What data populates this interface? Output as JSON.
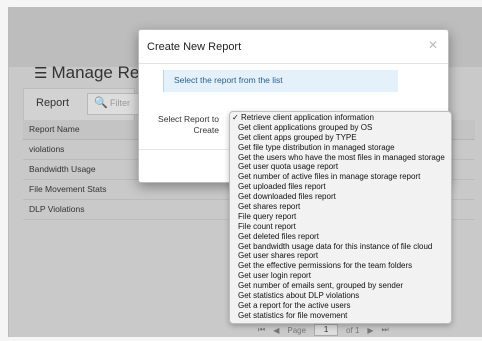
{
  "background_page": {
    "title": "Manage Reports",
    "title_icon": "list-icon",
    "report_tab_label": "Report",
    "search_placeholder": "Filter",
    "table": {
      "header": "Report Name",
      "rows": [
        "violations",
        "Bandwidth Usage",
        "File Movement Stats",
        "DLP Violations"
      ]
    },
    "pager": {
      "page_label": "Page",
      "page_value": "1",
      "of_label": "of 1"
    }
  },
  "modal": {
    "title": "Create New Report",
    "close_icon": "close-icon",
    "info_text": "Select the report from the list",
    "select_label_line1": "Select Report to",
    "select_label_line2": "Create"
  },
  "dropdown": {
    "checkmark": "✓",
    "options": [
      "Retrieve client application information",
      "Get client applications grouped by OS",
      "Get client apps grouped by TYPE",
      "Get file type distribution in managed storage",
      "Get the users who have the most files in managed storage",
      "Get user quota usage report",
      "Get number of active files in manage storage report",
      "Get uploaded files report",
      "Get downloaded files report",
      "Get shares report",
      "File query report",
      "File count report",
      "Get deleted files report",
      "Get bandwidth usage data for this instance of file cloud",
      "Get user shares report",
      "Get the effective permissions for the team folders",
      "Get user login report",
      "Get number of emails sent, grouped by sender",
      "Get statistics about DLP violations",
      "Get a report for the active users",
      "Get statistics for file movement"
    ],
    "selected_index": 0
  }
}
